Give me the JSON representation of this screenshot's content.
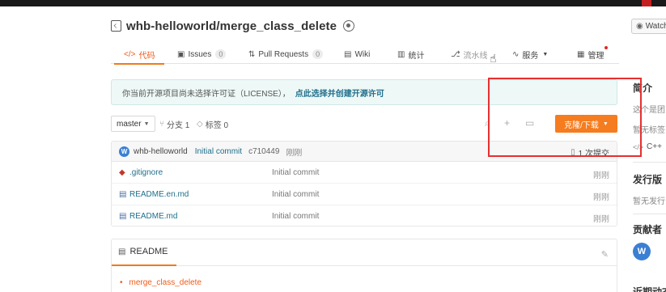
{
  "repo": {
    "title": "whb-helloworld/merge_class_delete",
    "watch_label": "Watch"
  },
  "tabs": [
    {
      "label": "代码",
      "icon": "code-icon"
    },
    {
      "label": "Issues",
      "icon": "issue-icon",
      "count": "0"
    },
    {
      "label": "Pull Requests",
      "icon": "pull-request-icon",
      "count": "0"
    },
    {
      "label": "Wiki",
      "icon": "wiki-icon"
    },
    {
      "label": "统计",
      "icon": "stats-icon"
    },
    {
      "label": "流水线",
      "icon": "pipeline-icon"
    },
    {
      "label": "服务",
      "icon": "service-icon"
    },
    {
      "label": "管理",
      "icon": "manage-icon"
    }
  ],
  "license": {
    "text": "你当前开源项目尚未选择许可证（LICENSE），",
    "link": "点此选择并创建开源许可"
  },
  "branch": {
    "selected": "master",
    "branch_count": "分支 1",
    "tag_count": "标签 0",
    "clone_label": "克隆/下载"
  },
  "commit": {
    "avatar_letter": "W",
    "author": "whb-helloworld",
    "message": "Initial commit",
    "hash": "c710449",
    "time": "刚刚",
    "commit_count": "1 次提交"
  },
  "files": [
    {
      "name": ".gitignore",
      "message": "Initial commit",
      "time": "刚刚",
      "icon": "git-file-icon"
    },
    {
      "name": "README.en.md",
      "message": "Initial commit",
      "time": "刚刚",
      "icon": "markdown-file-icon"
    },
    {
      "name": "README.md",
      "message": "Initial commit",
      "time": "刚刚",
      "icon": "markdown-file-icon"
    }
  ],
  "readme": {
    "tab_label": "README",
    "first_item": "merge_class_delete"
  },
  "sidebar": {
    "intro_title": "简介",
    "intro_text": "这个是团",
    "no_tags": "暂无标签",
    "language": "C++",
    "release_title": "发行版",
    "no_release": "暂无发行",
    "contributors_title": "贡献者",
    "contributor_letter": "W",
    "recent_title": "近期动态"
  },
  "colors": {
    "accent": "#f57c1f",
    "link": "#1f6f8b",
    "annotation_box": "#e53030",
    "avatar": "#3b7fd3"
  }
}
